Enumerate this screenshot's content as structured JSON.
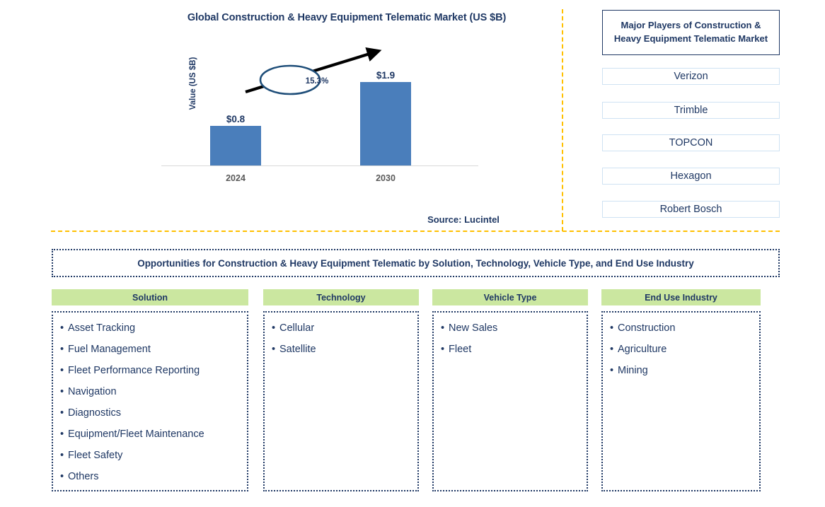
{
  "chart_data": {
    "type": "bar",
    "title": "Global Construction & Heavy Equipment Telematic Market (US $B)",
    "xlabel": "",
    "ylabel": "Value (US $B)",
    "categories": [
      "2024",
      "2030"
    ],
    "values": [
      0.8,
      1.9
    ],
    "value_labels": [
      "$0.8",
      "$1.9"
    ],
    "ylim": [
      0,
      2.1
    ],
    "grid": false,
    "legend_position": "none",
    "bar_color": "#4a7ebb",
    "annotations": [
      {
        "text": "15.3%",
        "type": "cagr-ellipse-with-arrow",
        "description": "growth arrow from 2024 bar to 2030 bar with CAGR callout"
      }
    ],
    "tick_label_color": "#595959",
    "axis_color": "#d9d9d9"
  },
  "header": {
    "title": "Global Construction & Heavy Equipment Telematic Market (US $B)",
    "source": "Source: Lucintel"
  },
  "colors": {
    "navy": "#1f3864",
    "bar_blue": "#4a7ebb",
    "header_green": "#cbe7a0",
    "divider_yellow": "#ffc000",
    "player_border": "#cfe2f3"
  },
  "players_panel": {
    "title": "Major Players of Construction & Heavy Equipment Telematic Market",
    "items": [
      {
        "label": "Verizon"
      },
      {
        "label": "Trimble"
      },
      {
        "label": "TOPCON"
      },
      {
        "label": "Hexagon"
      },
      {
        "label": "Robert Bosch"
      }
    ]
  },
  "opportunities": {
    "banner": "Opportunities for Construction & Heavy Equipment Telematic by Solution, Technology, Vehicle Type, and End Use Industry",
    "columns": [
      {
        "header": "Solution",
        "items": [
          "Asset Tracking",
          "Fuel Management",
          "Fleet Performance Reporting",
          "Navigation",
          "Diagnostics",
          "Equipment/Fleet Maintenance",
          "Fleet Safety",
          "Others"
        ]
      },
      {
        "header": "Technology",
        "items": [
          "Cellular",
          "Satellite"
        ]
      },
      {
        "header": "Vehicle Type",
        "items": [
          "New Sales",
          "Fleet"
        ]
      },
      {
        "header": "End Use Industry",
        "items": [
          "Construction",
          "Agriculture",
          "Mining"
        ]
      }
    ]
  },
  "bullet": "•"
}
